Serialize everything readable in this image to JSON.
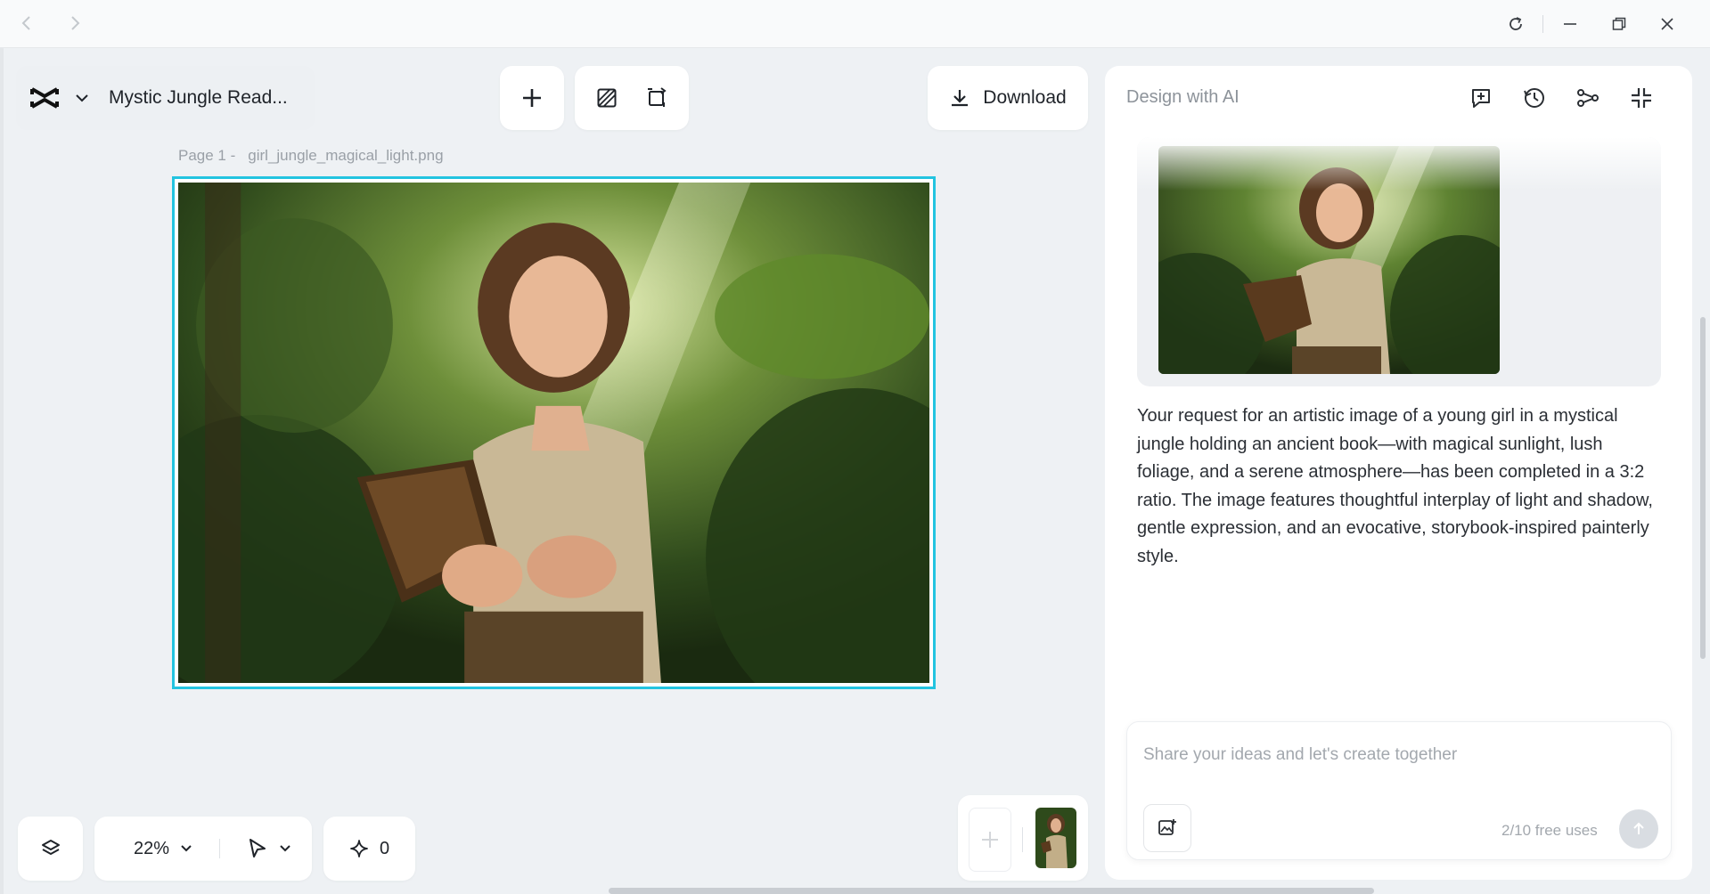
{
  "window": {
    "back_icon": "chevron-left-icon",
    "forward_icon": "chevron-right-icon",
    "controls": [
      "reload-icon",
      "minimize-icon",
      "restore-icon",
      "close-icon"
    ]
  },
  "project": {
    "logo": "capcut-logo",
    "title": "Mystic Jungle Read..."
  },
  "toolbar": {
    "add_icon": "plus-icon",
    "tool_icons": [
      "shading-icon",
      "crop-rotate-icon"
    ],
    "download_label": "Download"
  },
  "canvas": {
    "page_prefix": "Page 1 -",
    "file_name": "girl_jungle_magical_light.png",
    "accent_color": "#23c4e0"
  },
  "ai_panel": {
    "title": "Design with AI",
    "header_icons": [
      "new-chat-icon",
      "history-icon",
      "share-icon",
      "collapse-icon"
    ],
    "response_text": "Your request for an artistic image of a young girl in a mystical jungle holding an ancient book—with magical sunlight, lush foliage, and a serene atmosphere—has been completed in a 3:2 ratio. The image features thoughtful interplay of light and shadow, gentle expression, and an evocative, storybook-inspired painterly style.",
    "composer_placeholder": "Share your ideas and let's create together",
    "composer_value": "",
    "free_uses": "2/10 free uses"
  },
  "bottom_bar": {
    "zoom": "22%",
    "credits": "0"
  }
}
